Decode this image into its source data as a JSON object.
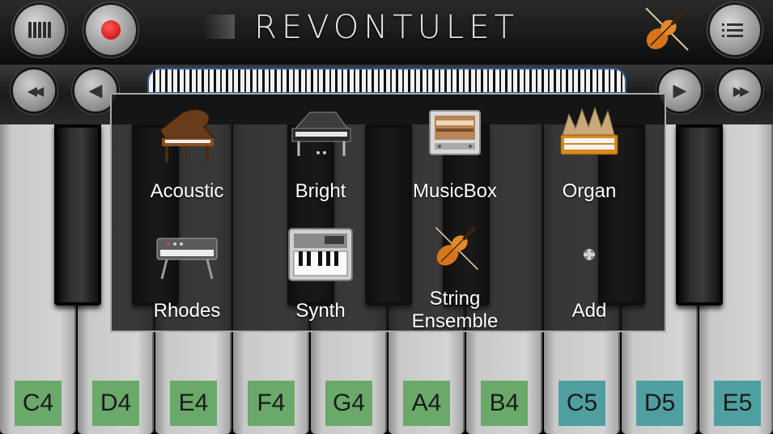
{
  "app": {
    "title": "REVONTULET"
  },
  "icons": {
    "keyboard": "keyboard-icon",
    "record": "record-icon",
    "violin": "violin-icon",
    "menu": "menu-icon",
    "rewind": "rewind-icon",
    "prev": "prev-icon",
    "next": "next-icon",
    "fast_forward": "fast-forward-icon"
  },
  "nav": {
    "rewind": "◀◀",
    "prev": "◀",
    "next": "▶",
    "fast_forward": "▶▶"
  },
  "instrument_picker": {
    "items": [
      {
        "label": "Acoustic",
        "icon": "grand-piano-icon"
      },
      {
        "label": "Bright",
        "icon": "piano-icon"
      },
      {
        "label": "MusicBox",
        "icon": "music-box-icon"
      },
      {
        "label": "Organ",
        "icon": "organ-icon"
      },
      {
        "label": "Rhodes",
        "icon": "electric-piano-icon"
      },
      {
        "label": "Synth",
        "icon": "synth-icon"
      },
      {
        "label": "String Ensemble",
        "icon": "violin-icon"
      },
      {
        "label": "Add",
        "icon": "add-icon"
      }
    ]
  },
  "keys": {
    "white": [
      "C4",
      "D4",
      "E4",
      "F4",
      "G4",
      "A4",
      "B4",
      "C5",
      "D5",
      "E5"
    ],
    "label_colors": {
      "octave4": "#6aa96a",
      "octave5": "#4f9fa0"
    }
  }
}
